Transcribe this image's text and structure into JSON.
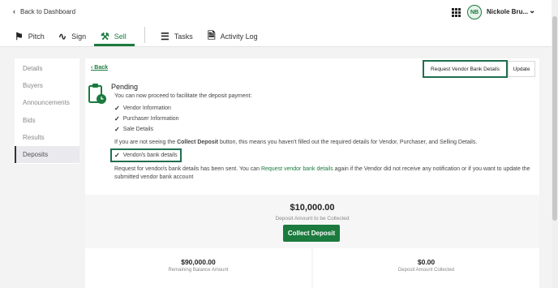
{
  "topbar": {
    "back_label": "Back to Dashboard",
    "user_initials": "NB",
    "user_name": "Nickole Bru..."
  },
  "nav": {
    "tabs": [
      {
        "label": "Pitch",
        "icon": "megaphone-icon"
      },
      {
        "label": "Sign",
        "icon": "signature-icon"
      },
      {
        "label": "Sell",
        "icon": "gavel-icon",
        "active": true
      },
      {
        "label": "Tasks",
        "icon": "checklist-icon"
      },
      {
        "label": "Activity Log",
        "icon": "document-icon"
      }
    ]
  },
  "sidebar": {
    "items": [
      {
        "label": "Details"
      },
      {
        "label": "Buyers"
      },
      {
        "label": "Announcements"
      },
      {
        "label": "Bids"
      },
      {
        "label": "Results"
      },
      {
        "label": "Deposits",
        "active": true
      }
    ]
  },
  "panel": {
    "back_label": "Back",
    "request_button": "Request Vendor Bank Details",
    "update_button": "Update",
    "status_title": "Pending",
    "intro": "You can now proceed to facilitate the deposit payment:",
    "checklist": [
      "Vendor Information",
      "Purchaser Information",
      "Sale Details"
    ],
    "collect_note_pre": "If you are not seeing the ",
    "collect_note_bold": "Collect Deposit",
    "collect_note_post": " button, this means you haven't filled out the required details for Vendor, Purchaser, and Selling Details.",
    "vendor_bank_check": "Vendor/s bank details",
    "request_msg_pre": "Request for vendor/s bank details has been sent. You can ",
    "request_msg_link": "Request vendor bank details",
    "request_msg_post": " again if the Vendor did not receive any notification or if you want to update the",
    "request_msg_line2": "submitted vendor bank account"
  },
  "summary": {
    "deposit_amount": "$10,000.00",
    "deposit_label": "Deposit Amount to be Collected",
    "collect_button": "Collect Deposit",
    "remaining_value": "$90,000.00",
    "remaining_label": "Remaining Balance Amount",
    "collected_value": "$0.00",
    "collected_label": "Deposit Amount Collected"
  },
  "colors": {
    "brand_green": "#1b7a3e",
    "highlight_box": "#1f6f4e"
  }
}
